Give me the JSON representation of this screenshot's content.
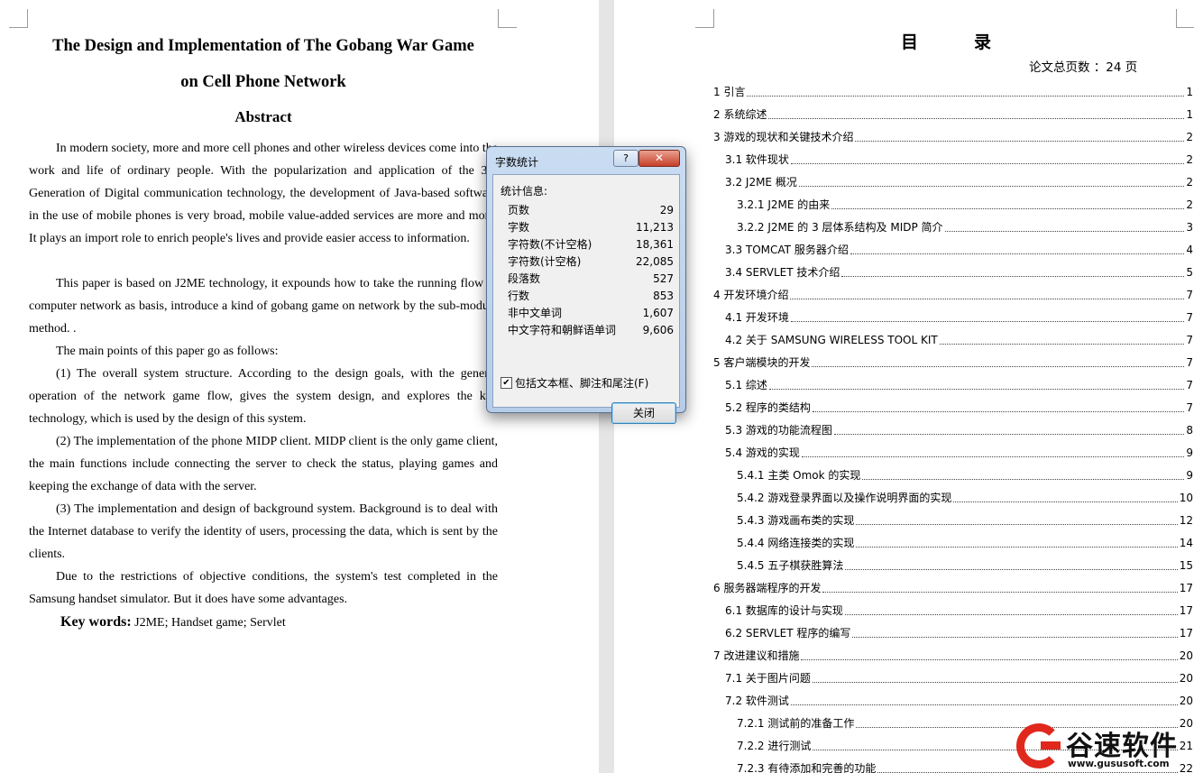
{
  "left_page": {
    "title_line1": "The Design and Implementation of The Gobang War Game",
    "title_line2": "on Cell Phone Network",
    "abstract_heading": "Abstract",
    "para1": "In modern society, more and more cell phones and other wireless devices come into the work and life of ordinary people. With the popularization and application of the 3rd Generation of Digital communication technology, the development of Java-based software in the use of mobile phones is very broad, mobile value-added services are more and more. It plays an import role to enrich people's lives and provide easier access to information.",
    "para2": "This paper is based on J2ME technology, it expounds how to take the running flow of computer network as basis, introduce a kind of gobang game on network by the sub-module method. .",
    "para3": "The main points of this paper go as follows:",
    "para4": "(1) The overall system structure. According to the design goals, with the general operation of the network game flow, gives the system design, and explores the key technology, which is used by the design of this system.",
    "para5": "(2) The implementation of the phone MIDP client. MIDP client is the only game client, the main functions include connecting the server to check the status, playing games and keeping the exchange of data with the server.",
    "para6": "(3) The implementation and design of background system. Background is to deal with the Internet database to verify the identity of users, processing the data, which is sent by the clients.",
    "para7": "Due to the restrictions of objective conditions, the system's test completed in the Samsung handset simulator. But it does have some advantages.",
    "keywords_label": "Key words:",
    "keywords_value": "J2ME; Handset game; Servlet"
  },
  "dialog": {
    "title": "字数统计",
    "help_label": "?",
    "close_x": "✕",
    "stats_heading": "统计信息:",
    "stats": [
      {
        "label": "页数",
        "value": "29"
      },
      {
        "label": "字数",
        "value": "11,213"
      },
      {
        "label": "字符数(不计空格)",
        "value": "18,361"
      },
      {
        "label": "字符数(计空格)",
        "value": "22,085"
      },
      {
        "label": "段落数",
        "value": "527"
      },
      {
        "label": "行数",
        "value": "853"
      },
      {
        "label": "非中文单词",
        "value": "1,607"
      },
      {
        "label": "中文字符和朝鲜语单词",
        "value": "9,606"
      }
    ],
    "checkbox_label": "包括文本框、脚注和尾注(F)",
    "checkbox_checked": true,
    "close_button": "关闭"
  },
  "right_page": {
    "toc_title": "目录",
    "total_pages": "论文总页数 ：24 页",
    "toc": [
      {
        "text": "1 引言",
        "page": "1",
        "level": 1
      },
      {
        "text": "2 系统综述",
        "page": "1",
        "level": 1
      },
      {
        "text": "3 游戏的现状和关键技术介绍",
        "page": "2",
        "level": 1
      },
      {
        "text": "3.1 软件现状",
        "page": "2",
        "level": 2
      },
      {
        "text": "3.2 J2ME 概况",
        "page": "2",
        "level": 2
      },
      {
        "text": "3.2.1 J2ME 的由来",
        "page": "2",
        "level": 3
      },
      {
        "text": "3.2.2 J2ME 的 3 层体系结构及 MIDP 简介",
        "page": "3",
        "level": 3
      },
      {
        "text": "3.3 TOMCAT 服务器介绍",
        "page": "4",
        "level": 2
      },
      {
        "text": "3.4 SERVLET 技术介绍",
        "page": "5",
        "level": 2
      },
      {
        "text": "4 开发环境介绍",
        "page": "7",
        "level": 1
      },
      {
        "text": "4.1 开发环境",
        "page": "7",
        "level": 2
      },
      {
        "text": "4.2 关于 SAMSUNG WIRELESS TOOL KIT",
        "page": "7",
        "level": 2
      },
      {
        "text": "5 客户端模块的开发",
        "page": "7",
        "level": 1
      },
      {
        "text": "5.1 综述",
        "page": "7",
        "level": 2
      },
      {
        "text": "5.2 程序的类结构",
        "page": "7",
        "level": 2
      },
      {
        "text": "5.3 游戏的功能流程图",
        "page": "8",
        "level": 2
      },
      {
        "text": "5.4 游戏的实现",
        "page": "9",
        "level": 2
      },
      {
        "text": "5.4.1 主类 Omok 的实现",
        "page": "9",
        "level": 3
      },
      {
        "text": "5.4.2 游戏登录界面以及操作说明界面的实现",
        "page": "10",
        "level": 3
      },
      {
        "text": "5.4.3 游戏画布类的实现",
        "page": "12",
        "level": 3
      },
      {
        "text": "5.4.4 网络连接类的实现",
        "page": "14",
        "level": 3
      },
      {
        "text": "5.4.5 五子棋获胜算法",
        "page": "15",
        "level": 3
      },
      {
        "text": "6 服务器端程序的开发",
        "page": "17",
        "level": 1
      },
      {
        "text": "6.1 数据库的设计与实现",
        "page": "17",
        "level": 2
      },
      {
        "text": "6.2 SERVLET 程序的编写",
        "page": "17",
        "level": 2
      },
      {
        "text": "7 改进建议和措施",
        "page": "20",
        "level": 1
      },
      {
        "text": "7.1 关于图片问题",
        "page": "20",
        "level": 2
      },
      {
        "text": "7.2 软件测试",
        "page": "20",
        "level": 2
      },
      {
        "text": "7.2.1 测试前的准备工作",
        "page": "20",
        "level": 3
      },
      {
        "text": "7.2.2 进行测试",
        "page": "21",
        "level": 3
      },
      {
        "text": "7.2.3 有待添加和完善的功能",
        "page": "22",
        "level": 3
      }
    ]
  },
  "watermark": {
    "brand": "谷速软件",
    "url": "www.gususoft.com"
  }
}
